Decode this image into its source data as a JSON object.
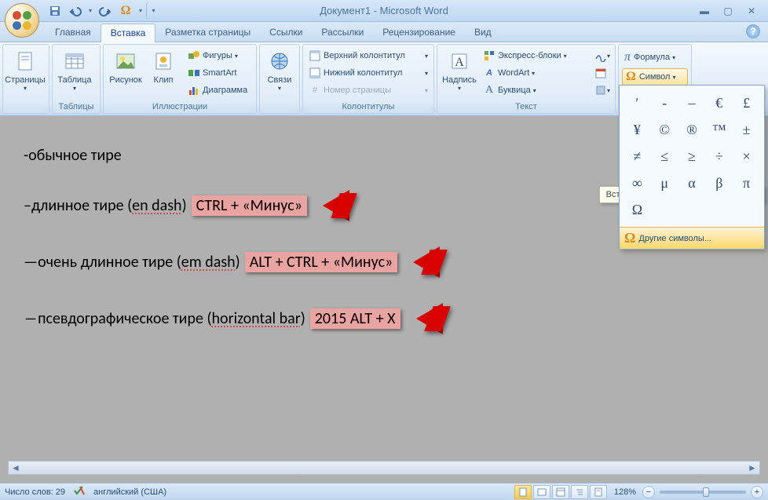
{
  "title": "Документ1 - Microsoft Word",
  "qat": {
    "save": "save-icon",
    "undo": "undo-icon",
    "redo": "redo-icon",
    "omega": "Ω"
  },
  "tabs": [
    "Главная",
    "Вставка",
    "Разметка страницы",
    "Ссылки",
    "Рассылки",
    "Рецензирование",
    "Вид"
  ],
  "active_tab": 1,
  "ribbon": {
    "pages": {
      "btn": "Страницы",
      "group": ""
    },
    "tables": {
      "btn": "Таблица",
      "group": "Таблицы"
    },
    "illus": {
      "pic": "Рисунок",
      "clip": "Клип",
      "shapes": "Фигуры",
      "smartart": "SmartArt",
      "chart": "Диаграмма",
      "group": "Иллюстрации"
    },
    "links": {
      "btn": "Связи",
      "group": ""
    },
    "headers": {
      "header": "Верхний колонтитул",
      "footer": "Нижний колонтитул",
      "pagenum": "Номер страницы",
      "group": "Колонтитулы"
    },
    "text": {
      "textbox": "Надпись",
      "quickparts": "Экспресс-блоки",
      "wordart": "WordArt",
      "dropcap": "Буквица",
      "group": "Текст"
    },
    "symbols": {
      "formula": "Формула",
      "symbol": "Символ",
      "group": ""
    }
  },
  "symbol_dd": {
    "grid": [
      "ʹ",
      "-",
      "‒",
      "€",
      "£",
      "¥",
      "©",
      "®",
      "™",
      "±",
      "≠",
      "≤",
      "≥",
      "÷",
      "×",
      "∞",
      "μ",
      "α",
      "β",
      "π",
      "Ω"
    ],
    "more": "Другие символы...",
    "tooltip": "Вставить символ из диалогового окна"
  },
  "document": {
    "lines": [
      {
        "prefix": "- ",
        "text": "обычное тире",
        "hint": "",
        "arrow": false
      },
      {
        "prefix": "– ",
        "text": "длинное тире (",
        "dotted": "en dash",
        "after": ") ",
        "hint": "CTRL + «Минус»",
        "arrow": true
      },
      {
        "prefix": "— ",
        "text": "очень длинное тире (",
        "dotted": "em dash",
        "after": ") ",
        "hint": "ALT + CTRL + «Минус»",
        "arrow": true
      },
      {
        "prefix": "― ",
        "text": "псевдографическое тире (",
        "dotted": "horizontal bar",
        "after": ") ",
        "hint": "2015 ALT + X",
        "arrow": true
      }
    ]
  },
  "status": {
    "words": "Число слов: 29",
    "lang": "английский (США)",
    "zoom": "128%"
  }
}
